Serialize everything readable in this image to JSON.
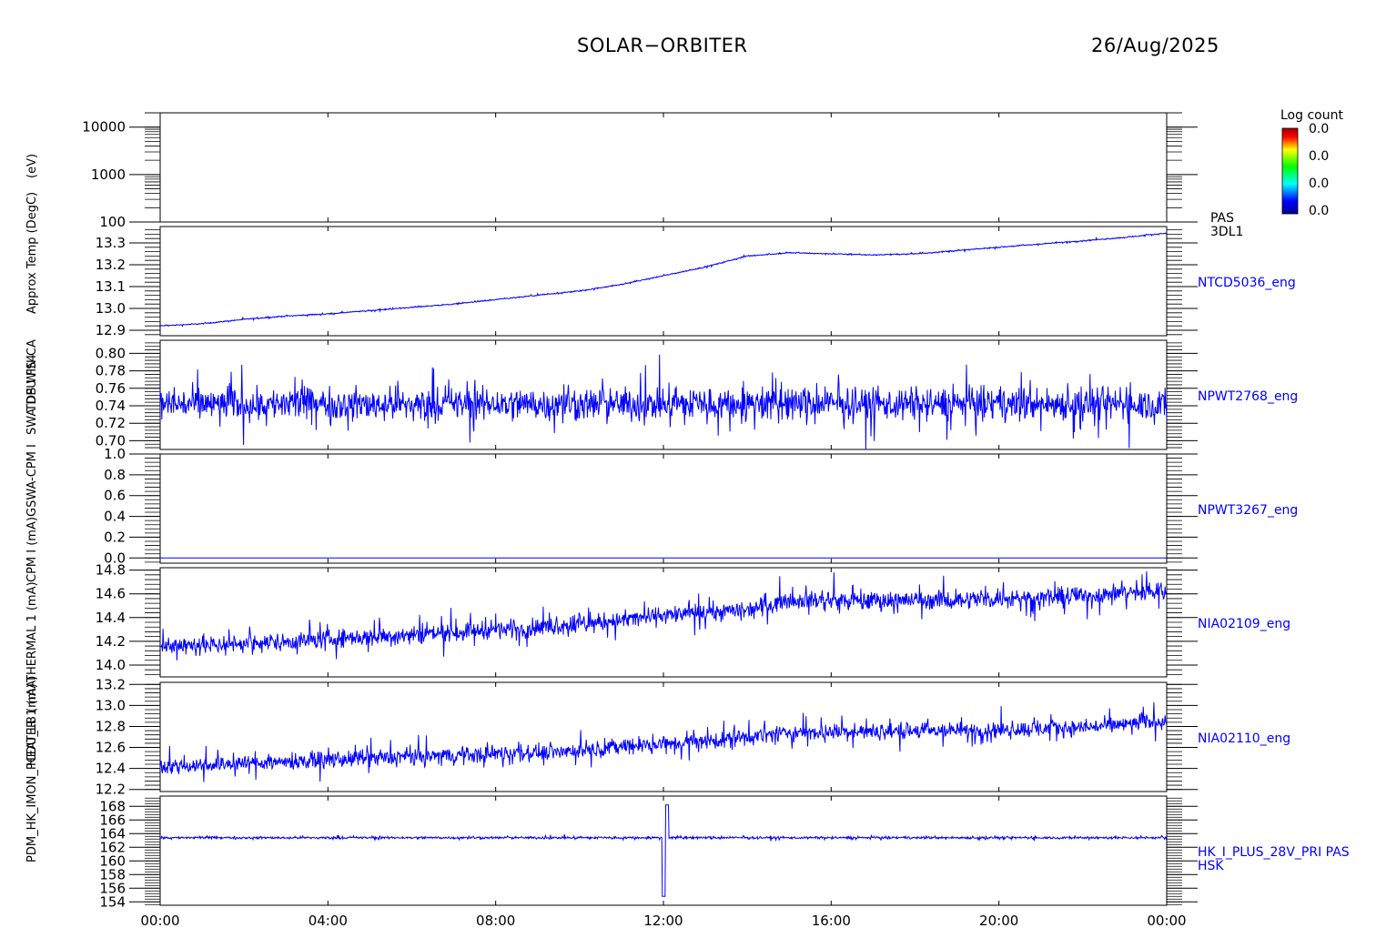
{
  "header": {
    "title": "SOLAR−ORBITER",
    "date": "26/Aug/2025"
  },
  "colorbar": {
    "title": "Log count",
    "tick_labels": [
      "0.0",
      "0.0",
      "0.0",
      "0.0"
    ]
  },
  "y_labels_left": [
    "(eV)",
    "Approx Temp (DegC)",
    "TDS WIN CA",
    "SWA DPU FS4",
    "GSWA-CPM I",
    "CPM I (mA)",
    "THERMAL 1 (mA)",
    "HEATER 1 (mA)",
    "PDM_HK_IMON_PCDU_LB (mA)"
  ],
  "colors": {
    "series": "#0000ff",
    "axis": "#000000"
  },
  "chart_data": [
    {
      "type": "heatmap",
      "name": "PAS 3DL1",
      "right_label": [
        "PAS",
        "3DL1"
      ],
      "y_scale": "log",
      "ylim": [
        100,
        20000
      ],
      "yticks": [
        100,
        1000,
        10000
      ],
      "ytick_labels": [
        "100",
        "1000",
        "10000"
      ],
      "values": []
    },
    {
      "type": "line",
      "name": "NTCD5036_eng",
      "right_label": [
        "NTCD5036_eng"
      ],
      "ylim": [
        12.875,
        13.375
      ],
      "yticks": [
        12.9,
        13.0,
        13.1,
        13.2,
        13.3
      ],
      "ytick_labels": [
        "12.9",
        "13.0",
        "13.1",
        "13.2",
        "13.3"
      ],
      "x": [
        0,
        1,
        2,
        3,
        4,
        5,
        6,
        7,
        8,
        9,
        10,
        11,
        12,
        13,
        14,
        15,
        16,
        17,
        18,
        19,
        20,
        21,
        22,
        23,
        24
      ],
      "values": [
        12.92,
        12.93,
        12.95,
        12.965,
        12.975,
        12.99,
        13.005,
        13.02,
        13.04,
        13.06,
        13.08,
        13.11,
        13.15,
        13.19,
        13.24,
        13.255,
        13.25,
        13.245,
        13.25,
        13.265,
        13.28,
        13.295,
        13.31,
        13.325,
        13.345
      ],
      "noise": 0.003
    },
    {
      "type": "line",
      "name": "NPWT2768_eng",
      "right_label": [
        "NPWT2768_eng"
      ],
      "ylim": [
        0.69,
        0.815
      ],
      "yticks": [
        0.7,
        0.72,
        0.74,
        0.76,
        0.78,
        0.8
      ],
      "ytick_labels": [
        "0.70",
        "0.72",
        "0.74",
        "0.76",
        "0.78",
        "0.80"
      ],
      "x": [
        0,
        24
      ],
      "values": [
        0.742,
        0.742
      ],
      "noise": 0.022
    },
    {
      "type": "line",
      "name": "NPWT3267_eng",
      "right_label": [
        "NPWT3267_eng"
      ],
      "ylim": [
        -0.05,
        1.0
      ],
      "yticks": [
        0.0,
        0.2,
        0.4,
        0.6,
        0.8,
        1.0
      ],
      "ytick_labels": [
        "0.0",
        "0.2",
        "0.4",
        "0.6",
        "0.8",
        "1.0"
      ],
      "x": [
        0,
        24
      ],
      "values": [
        0.0,
        0.0
      ],
      "noise": 0.0
    },
    {
      "type": "line",
      "name": "NIA02109_eng",
      "right_label": [
        "NIA02109_eng"
      ],
      "ylim": [
        13.9,
        14.82
      ],
      "yticks": [
        14.0,
        14.2,
        14.4,
        14.6,
        14.8
      ],
      "ytick_labels": [
        "14.0",
        "14.2",
        "14.4",
        "14.6",
        "14.8"
      ],
      "x": [
        0,
        2,
        4,
        6,
        8,
        10,
        11,
        12,
        13,
        14,
        15,
        17,
        19,
        21,
        22,
        23,
        24
      ],
      "values": [
        14.16,
        14.18,
        14.22,
        14.26,
        14.3,
        14.34,
        14.38,
        14.42,
        14.44,
        14.47,
        14.55,
        14.54,
        14.55,
        14.57,
        14.58,
        14.61,
        14.62
      ],
      "noise": 0.09
    },
    {
      "type": "line",
      "name": "NIA02110_eng",
      "right_label": [
        "NIA02110_eng"
      ],
      "ylim": [
        12.18,
        13.22
      ],
      "yticks": [
        12.2,
        12.4,
        12.6,
        12.8,
        13.0,
        13.2
      ],
      "ytick_labels": [
        "12.2",
        "12.4",
        "12.6",
        "12.8",
        "13.0",
        "13.2"
      ],
      "x": [
        0,
        2,
        4,
        6,
        8,
        10,
        11,
        12,
        13,
        14,
        15,
        17,
        19,
        21,
        22,
        23,
        24
      ],
      "values": [
        12.42,
        12.45,
        12.48,
        12.51,
        12.54,
        12.57,
        12.61,
        12.63,
        12.66,
        12.7,
        12.74,
        12.75,
        12.76,
        12.78,
        12.79,
        12.82,
        12.86
      ],
      "noise": 0.09
    },
    {
      "type": "line",
      "name": "HK_I_PLUS_28V_PRI PAS HSK",
      "right_label": [
        "HK_I_PLUS_28V_PRI PAS",
        "HSK"
      ],
      "ylim": [
        153.5,
        169.5
      ],
      "yticks": [
        154,
        156,
        158,
        160,
        162,
        164,
        166,
        168
      ],
      "ytick_labels": [
        "154",
        "156",
        "158",
        "160",
        "162",
        "164",
        "166",
        "168"
      ],
      "x": [
        0,
        24
      ],
      "values": [
        163.4,
        163.4
      ],
      "noise": 0.2,
      "spike": {
        "x": 12.05,
        "min": 154.8,
        "max": 168.2
      }
    }
  ],
  "xaxis": {
    "tick_labels": [
      "00:00",
      "04:00",
      "08:00",
      "12:00",
      "16:00",
      "20:00",
      "00:00"
    ],
    "xlim": [
      0,
      24
    ]
  }
}
